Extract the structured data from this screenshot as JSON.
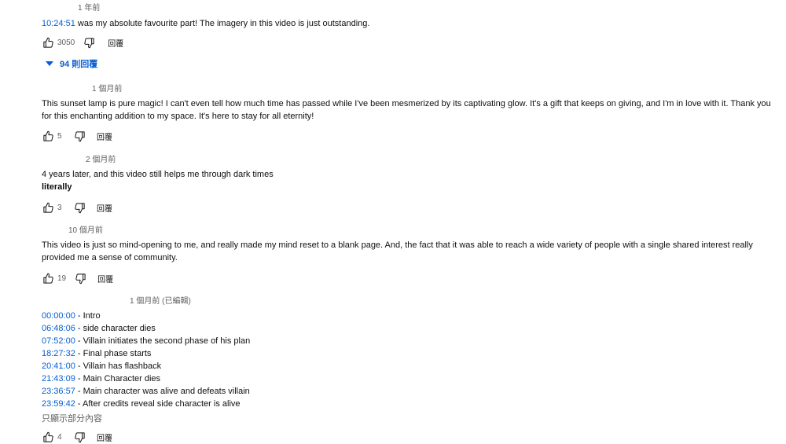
{
  "comments": [
    {
      "time": "1 年前",
      "timestamp": "10:24:51",
      "text": " was my absolute favourite  part! The imagery in this video is just outstanding.",
      "likes": "3050",
      "reply_label": "回覆",
      "replies_label": "94 則回覆"
    },
    {
      "time": "1 個月前",
      "text": "This sunset lamp is pure magic! I can't even tell how much time has passed while I've been mesmerized by its captivating glow. It's a gift that keeps on giving, and I'm in love with it. Thank you for this enchanting addition to my space. It's here to stay for all eternity!",
      "likes": "5",
      "reply_label": "回覆"
    },
    {
      "time": "2 個月前",
      "text": "4 years later, and this video still helps me through dark times",
      "bold_text": "literally",
      "likes": "3",
      "reply_label": "回覆"
    },
    {
      "time": "10 個月前",
      "text": "This video is just so mind-opening to me, and really made my mind reset to a blank page. And, the fact that it was able to reach a wide variety of people with a single shared interest really provided me a sense of community.",
      "likes": "19",
      "reply_label": "回覆"
    },
    {
      "time": "1 個月前 (已編輯)",
      "chapters": [
        {
          "ts": "00:00:00",
          "label": " - Intro"
        },
        {
          "ts": "06:48:06",
          "label": " - side character dies"
        },
        {
          "ts": "07:52:00",
          "label": " - Villain initiates the second phase of his plan"
        },
        {
          "ts": "18:27:32",
          "label": " - Final phase starts"
        },
        {
          "ts": "20:41:00",
          "label": " - Villain has flashback"
        },
        {
          "ts": "21:43:09",
          "label": " - Main Character dies"
        },
        {
          "ts": "23:36:57",
          "label": " - Main character was alive and defeats villain"
        },
        {
          "ts": "23:59:42",
          "label": " - After credits reveal side character is alive"
        }
      ],
      "show_partial": "只顯示部分內容",
      "likes": "4",
      "reply_label": "回覆"
    }
  ],
  "colors": {
    "link": "#065fd4",
    "meta": "#606060",
    "text": "#0f0f0f"
  },
  "icons": {
    "like": "thumb-up-icon",
    "dislike": "thumb-down-icon",
    "replies": "caret-down-icon"
  }
}
